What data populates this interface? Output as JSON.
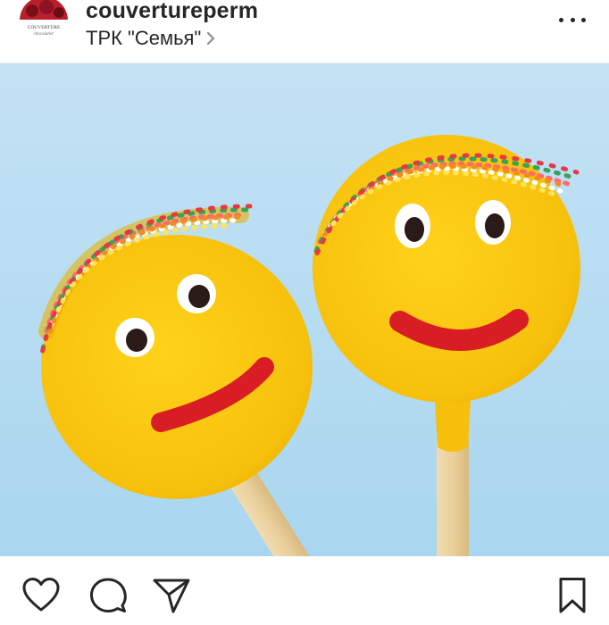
{
  "post": {
    "username": "couvertureperm",
    "location": "ТРК \"Семья\"",
    "avatar_text_top": "COUVERTURE",
    "avatar_text_bottom": "chocolatier"
  },
  "icons": {
    "more": "more-horizontal-icon",
    "like": "heart-icon",
    "comment": "comment-bubble-icon",
    "share": "paper-plane-icon",
    "save": "bookmark-icon",
    "location_chevron": "chevron-right-icon"
  },
  "colors": {
    "background_sky": "#bfe1f3",
    "candy_yellow": "#f6c20e",
    "smile_red": "#d81d25",
    "stick": "#e8cf9f",
    "text": "#262626"
  }
}
